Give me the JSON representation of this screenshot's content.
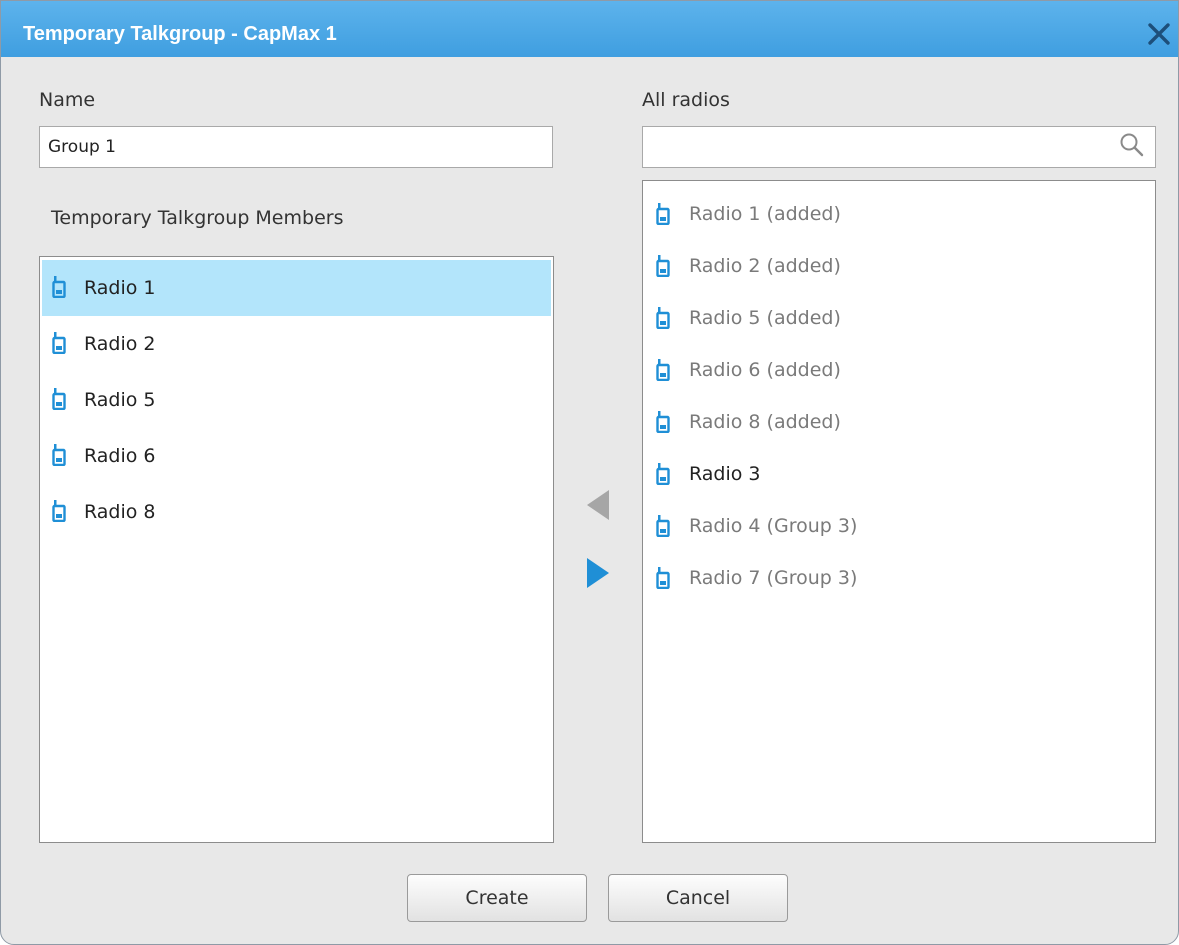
{
  "window": {
    "title": "Temporary Talkgroup - CapMax 1"
  },
  "name_section": {
    "label": "Name",
    "value": "Group 1"
  },
  "members_section": {
    "label": "Temporary Talkgroup Members",
    "items": [
      {
        "label": "Radio 1",
        "selected": true
      },
      {
        "label": "Radio 2",
        "selected": false
      },
      {
        "label": "Radio 5",
        "selected": false
      },
      {
        "label": "Radio 6",
        "selected": false
      },
      {
        "label": "Radio 8",
        "selected": false
      }
    ]
  },
  "all_radios_section": {
    "label": "All radios",
    "search_value": "",
    "items": [
      {
        "label": "Radio 1 (added)",
        "enabled": false
      },
      {
        "label": "Radio 2 (added)",
        "enabled": false
      },
      {
        "label": "Radio 5 (added)",
        "enabled": false
      },
      {
        "label": "Radio 6 (added)",
        "enabled": false
      },
      {
        "label": "Radio 8 (added)",
        "enabled": false
      },
      {
        "label": "Radio 3",
        "enabled": true
      },
      {
        "label": "Radio 4 (Group 3)",
        "enabled": false
      },
      {
        "label": "Radio 7 (Group 3)",
        "enabled": false
      }
    ]
  },
  "transfer": {
    "remove_icon": "triangle-left-icon",
    "add_icon": "triangle-right-icon"
  },
  "buttons": {
    "create_label": "Create",
    "cancel_label": "Cancel"
  },
  "colors": {
    "titlebar": "#4aa8e6",
    "selection": "#b3e5fb",
    "radio_icon": "#1f8fd6",
    "arrow_active": "#1f8fd6",
    "arrow_disabled": "#a6a6a6"
  }
}
